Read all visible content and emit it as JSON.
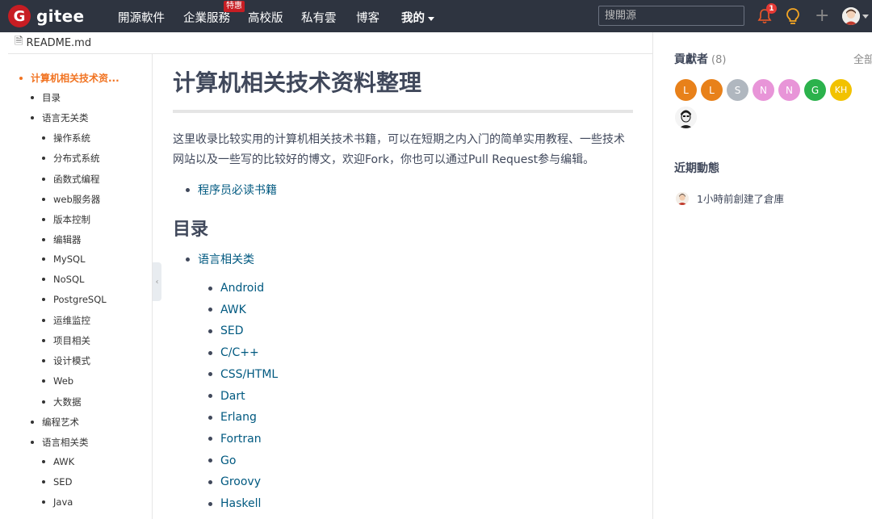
{
  "nav": {
    "logo_letter": "G",
    "logo_text": "gitee",
    "items": [
      "開源軟件",
      "企業服務",
      "高校版",
      "私有雲",
      "博客"
    ],
    "badge": "特惠",
    "mine": "我的",
    "search_placeholder": "搜開源",
    "notification_count": "1",
    "plus": "+"
  },
  "file": {
    "name": "README.md"
  },
  "toc": {
    "items": [
      {
        "label": "计算机相关技术资...",
        "level": 0,
        "active": true
      },
      {
        "label": "目录",
        "level": 1
      },
      {
        "label": "语言无关类",
        "level": 1
      },
      {
        "label": "操作系统",
        "level": 2
      },
      {
        "label": "分布式系统",
        "level": 2
      },
      {
        "label": "函数式编程",
        "level": 2
      },
      {
        "label": "web服务器",
        "level": 2
      },
      {
        "label": "版本控制",
        "level": 2
      },
      {
        "label": "编辑器",
        "level": 2
      },
      {
        "label": "MySQL",
        "level": 2
      },
      {
        "label": "NoSQL",
        "level": 2
      },
      {
        "label": "PostgreSQL",
        "level": 2
      },
      {
        "label": "运维监控",
        "level": 2
      },
      {
        "label": "项目相关",
        "level": 2
      },
      {
        "label": "设计模式",
        "level": 2
      },
      {
        "label": "Web",
        "level": 2
      },
      {
        "label": "大数据",
        "level": 2
      },
      {
        "label": "编程艺术",
        "level": 1
      },
      {
        "label": "语言相关类",
        "level": 1
      },
      {
        "label": "AWK",
        "level": 2
      },
      {
        "label": "SED",
        "level": 2
      },
      {
        "label": "Java",
        "level": 2
      }
    ]
  },
  "readme": {
    "title": "计算机相关技术资料整理",
    "intro": "这里收录比较实用的计算机相关技术书籍，可以在短期之内入门的简单实用教程、一些技术网站以及一些写的比较好的博文，欢迎Fork，你也可以通过Pull Request参与编辑。",
    "top_link": "程序员必读书籍",
    "toc_heading": "目录",
    "section_link": "语言相关类",
    "languages": [
      "Android",
      "AWK",
      "SED",
      "C/C++",
      "CSS/HTML",
      "Dart",
      "Erlang",
      "Fortran",
      "Go",
      "Groovy",
      "Haskell"
    ]
  },
  "sidebar": {
    "contributors_title": "貢獻者",
    "contributors_count": "(8)",
    "all_link": "全部",
    "contributors": [
      {
        "initial": "L",
        "color": "#e8811a"
      },
      {
        "initial": "L",
        "color": "#e8811a"
      },
      {
        "initial": "S",
        "color": "#b0b7bf"
      },
      {
        "initial": "N",
        "color": "#e895d8"
      },
      {
        "initial": "N",
        "color": "#e895d8"
      },
      {
        "initial": "G",
        "color": "#2bb24c"
      },
      {
        "initial": "KH",
        "color": "#f2c200"
      }
    ],
    "activity_title": "近期動態",
    "activity_text": "1小時前創建了倉庫"
  }
}
